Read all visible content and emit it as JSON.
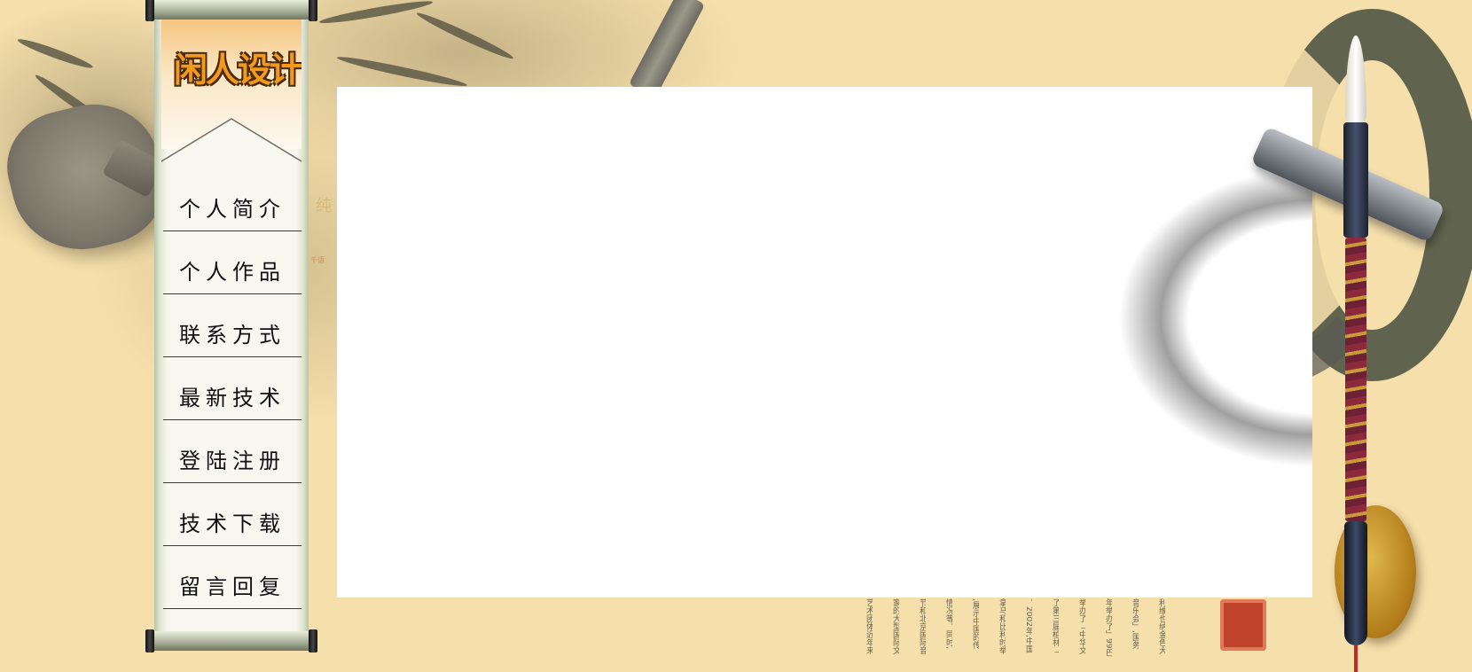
{
  "logo": {
    "text": "闲人设计"
  },
  "menu": {
    "items": [
      {
        "label": "个人简介"
      },
      {
        "label": "个人作品"
      },
      {
        "label": "联系方式"
      },
      {
        "label": "最新技术"
      },
      {
        "label": "登陆注册"
      },
      {
        "label": "技术下载"
      },
      {
        "label": "留言回复"
      }
    ]
  },
  "background_text": {
    "heading_fragment": "纯",
    "small_fragment": "千语",
    "columns": [
      "艺术团体近年来",
      "家的大型国际文",
      "节和北京国际音",
      "情况等。同时,",
      ",展示中国的传",
      "拿马和比利时举",
      "。2002年,中国",
      "了第三届柏林「",
      "举办了「中华文",
      "年举办了」99巴",
      "音乐会」,国务",
      "利维也纳金色大"
    ]
  },
  "colors": {
    "background": "#f5dfab",
    "logo_orange": "#f39a1c",
    "menu_text": "#111111",
    "content_bg": "#ffffff"
  }
}
